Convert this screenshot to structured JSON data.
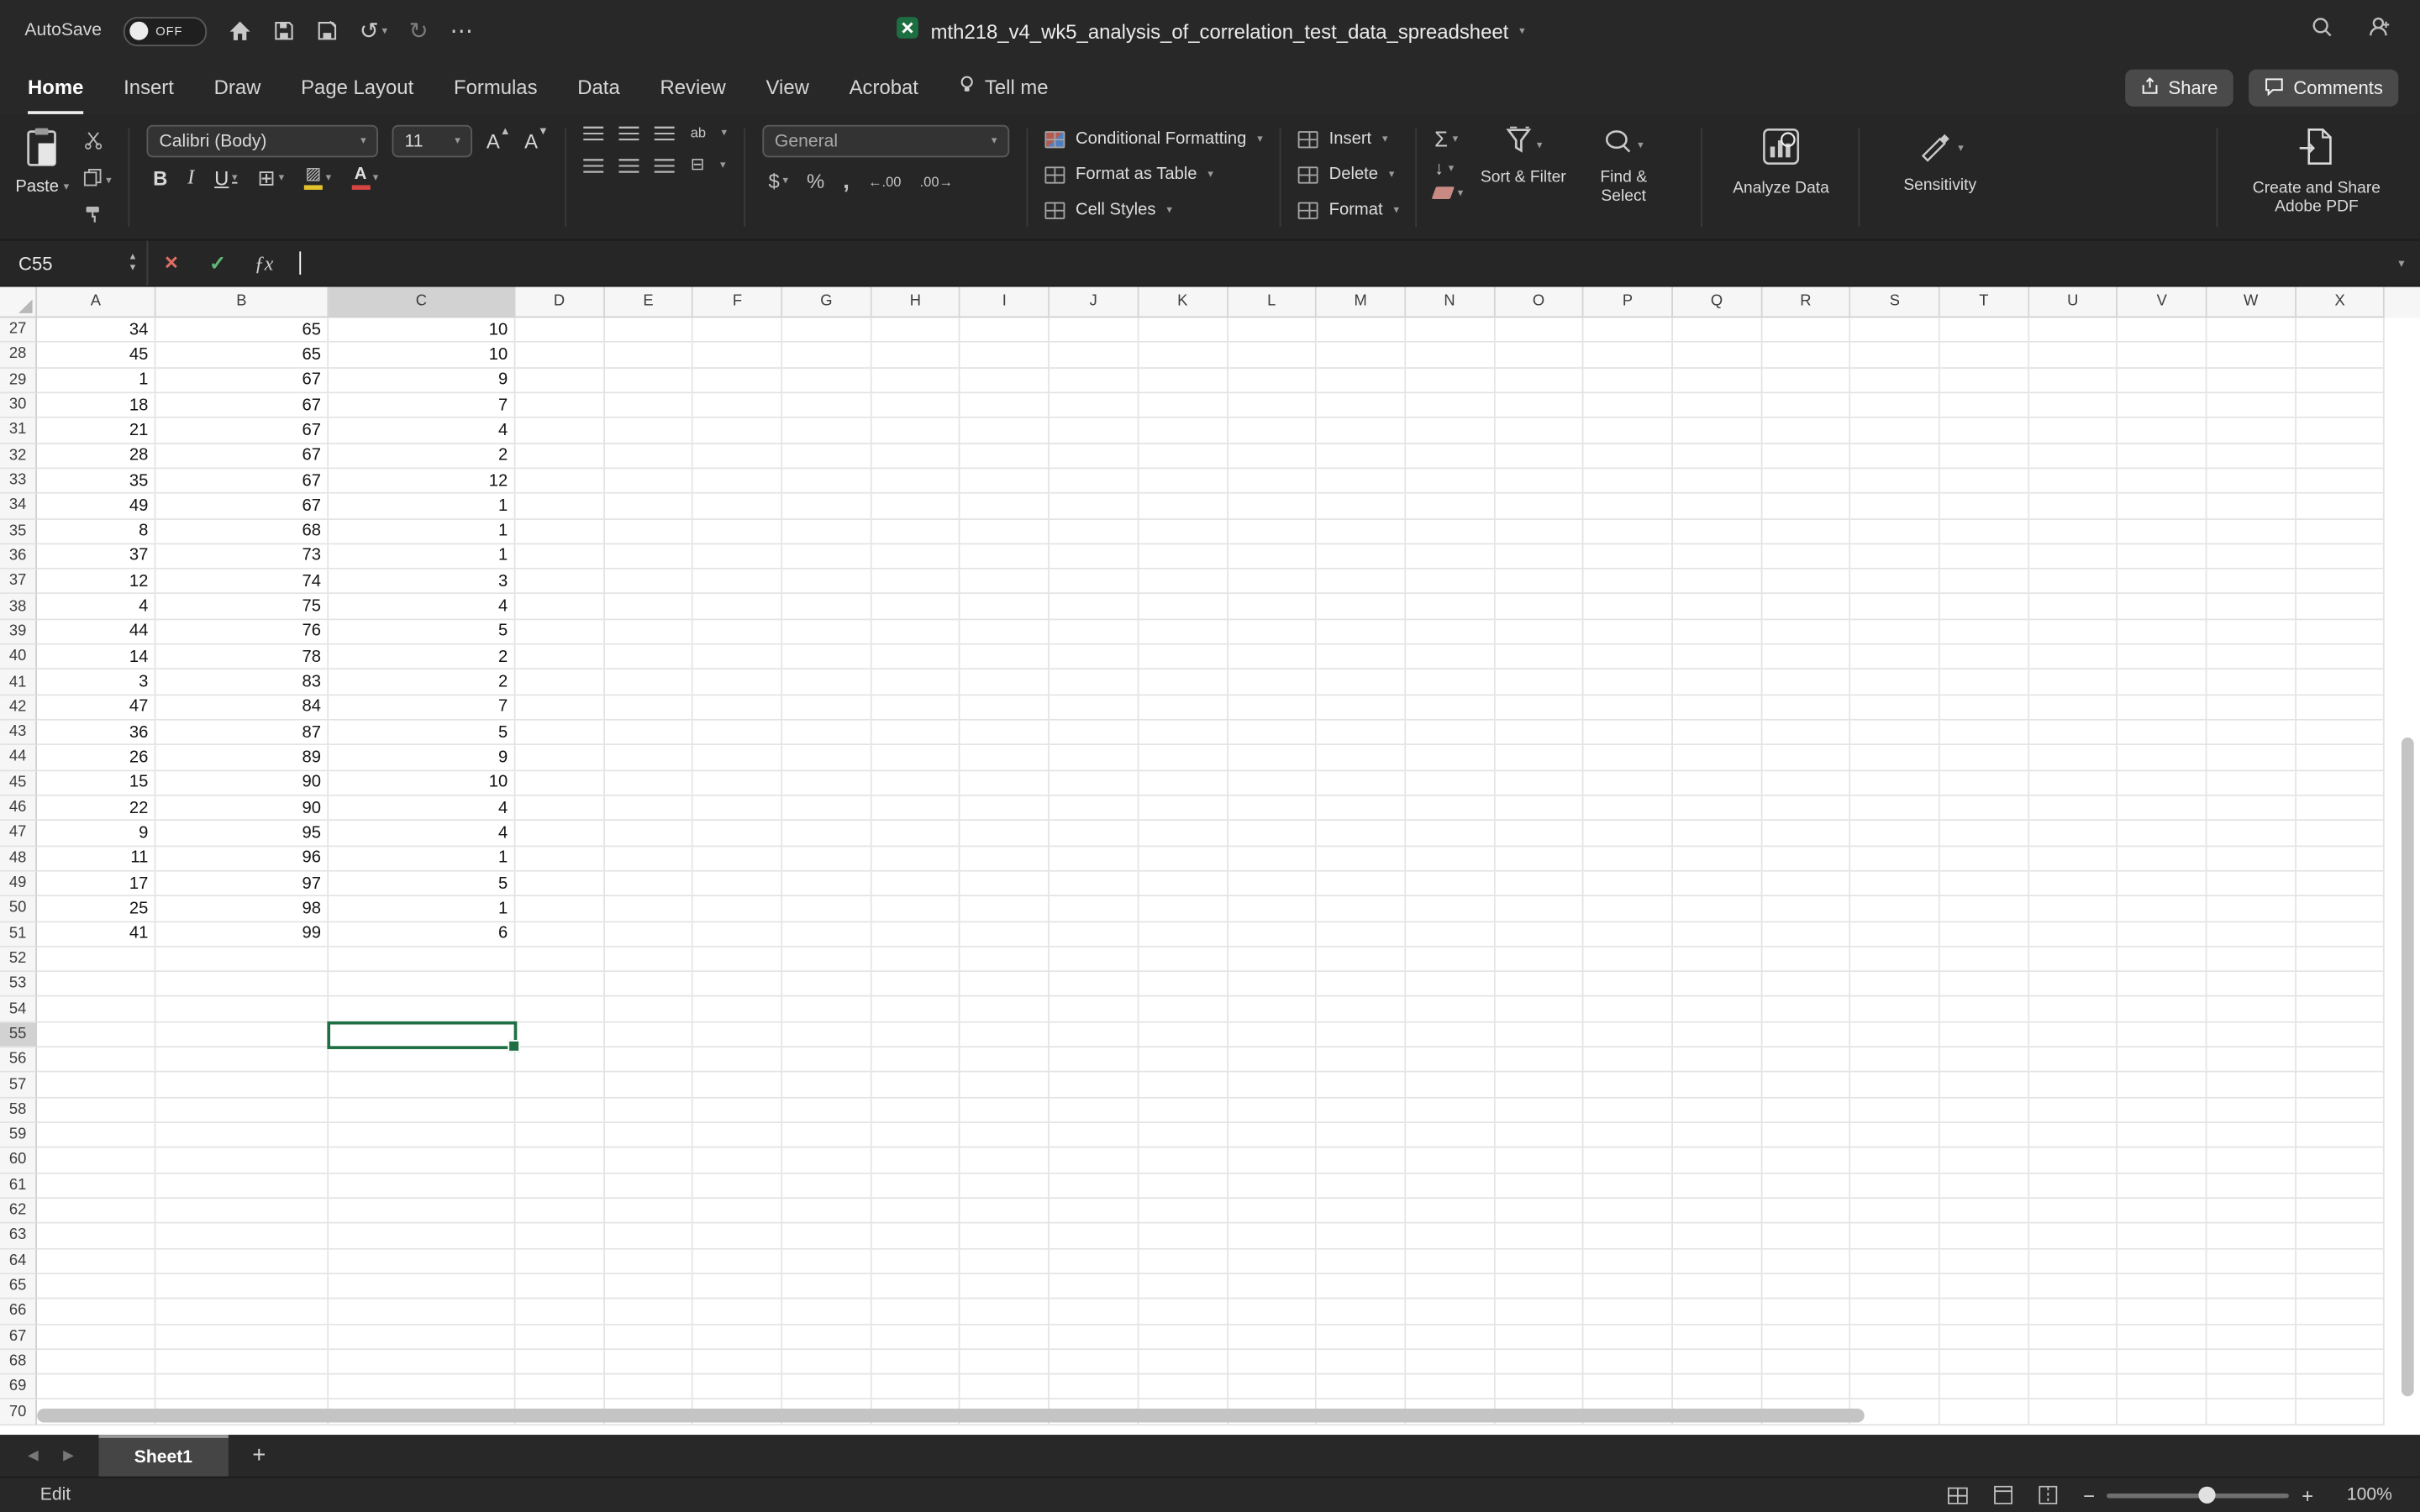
{
  "titlebar": {
    "autosave_label": "AutoSave",
    "autosave_state": "OFF",
    "document_title": "mth218_v4_wk5_analysis_of_correlation_test_data_spreadsheet"
  },
  "tabs": [
    {
      "label": "Home",
      "active": true
    },
    {
      "label": "Insert"
    },
    {
      "label": "Draw"
    },
    {
      "label": "Page Layout"
    },
    {
      "label": "Formulas"
    },
    {
      "label": "Data"
    },
    {
      "label": "Review"
    },
    {
      "label": "View"
    },
    {
      "label": "Acrobat"
    },
    {
      "label": "Tell me",
      "icon": "lightbulb"
    }
  ],
  "actions": {
    "share_label": "Share",
    "comments_label": "Comments"
  },
  "ribbon": {
    "paste_label": "Paste",
    "font_name": "Calibri (Body)",
    "font_size": "11",
    "number_format": "General",
    "styles_buttons": [
      "Conditional Formatting",
      "Format as Table",
      "Cell Styles"
    ],
    "cells_buttons": [
      "Insert",
      "Delete",
      "Format"
    ],
    "sort_filter_label": "Sort & Filter",
    "find_select_label": "Find & Select",
    "analyze_label": "Analyze Data",
    "sensitivity_label": "Sensitivity",
    "adobe_label": "Create and Share Adobe PDF"
  },
  "formula_bar": {
    "cell_reference": "C55",
    "fx_label": "ƒx",
    "input_value": ""
  },
  "sheet": {
    "column_headers": [
      "A",
      "B",
      "C",
      "D",
      "E",
      "F",
      "G",
      "H",
      "I",
      "J",
      "K",
      "L",
      "M",
      "N",
      "O",
      "P",
      "Q",
      "R",
      "S",
      "T",
      "U",
      "V",
      "W",
      "X"
    ],
    "row_start": 27,
    "row_end": 70,
    "selected_cell": {
      "column": "C",
      "row": 55
    },
    "data_rows": [
      {
        "row": 27,
        "A": "34",
        "B": "65",
        "C": "10"
      },
      {
        "row": 28,
        "A": "45",
        "B": "65",
        "C": "10"
      },
      {
        "row": 29,
        "A": "1",
        "B": "67",
        "C": "9"
      },
      {
        "row": 30,
        "A": "18",
        "B": "67",
        "C": "7"
      },
      {
        "row": 31,
        "A": "21",
        "B": "67",
        "C": "4"
      },
      {
        "row": 32,
        "A": "28",
        "B": "67",
        "C": "2"
      },
      {
        "row": 33,
        "A": "35",
        "B": "67",
        "C": "12"
      },
      {
        "row": 34,
        "A": "49",
        "B": "67",
        "C": "1"
      },
      {
        "row": 35,
        "A": "8",
        "B": "68",
        "C": "1"
      },
      {
        "row": 36,
        "A": "37",
        "B": "73",
        "C": "1"
      },
      {
        "row": 37,
        "A": "12",
        "B": "74",
        "C": "3"
      },
      {
        "row": 38,
        "A": "4",
        "B": "75",
        "C": "4"
      },
      {
        "row": 39,
        "A": "44",
        "B": "76",
        "C": "5"
      },
      {
        "row": 40,
        "A": "14",
        "B": "78",
        "C": "2"
      },
      {
        "row": 41,
        "A": "3",
        "B": "83",
        "C": "2"
      },
      {
        "row": 42,
        "A": "47",
        "B": "84",
        "C": "7"
      },
      {
        "row": 43,
        "A": "36",
        "B": "87",
        "C": "5"
      },
      {
        "row": 44,
        "A": "26",
        "B": "89",
        "C": "9"
      },
      {
        "row": 45,
        "A": "15",
        "B": "90",
        "C": "10"
      },
      {
        "row": 46,
        "A": "22",
        "B": "90",
        "C": "4"
      },
      {
        "row": 47,
        "A": "9",
        "B": "95",
        "C": "4"
      },
      {
        "row": 48,
        "A": "11",
        "B": "96",
        "C": "1"
      },
      {
        "row": 49,
        "A": "17",
        "B": "97",
        "C": "5"
      },
      {
        "row": 50,
        "A": "25",
        "B": "98",
        "C": "1"
      },
      {
        "row": 51,
        "A": "41",
        "B": "99",
        "C": "6"
      }
    ]
  },
  "sheet_tabs": {
    "active_sheet": "Sheet1",
    "add_sheet_label": "+"
  },
  "status_bar": {
    "mode_label": "Edit",
    "zoom_label": "100%"
  }
}
